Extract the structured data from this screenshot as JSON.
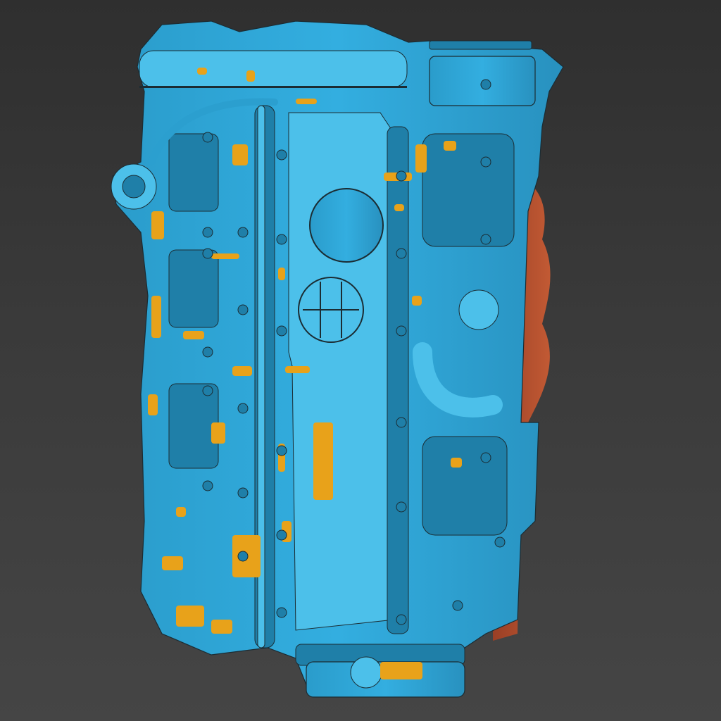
{
  "viewer": {
    "background_top": "#2f2f2f",
    "background_bottom": "#454545"
  },
  "model": {
    "primary_color": "#2b9fcf",
    "primary_dark": "#1f7fa8",
    "highlight_color": "#4cc0ea",
    "deviation_orange": "#e8a21a",
    "deviation_red": "#b4502c",
    "outline_color": "#1b2c33"
  }
}
